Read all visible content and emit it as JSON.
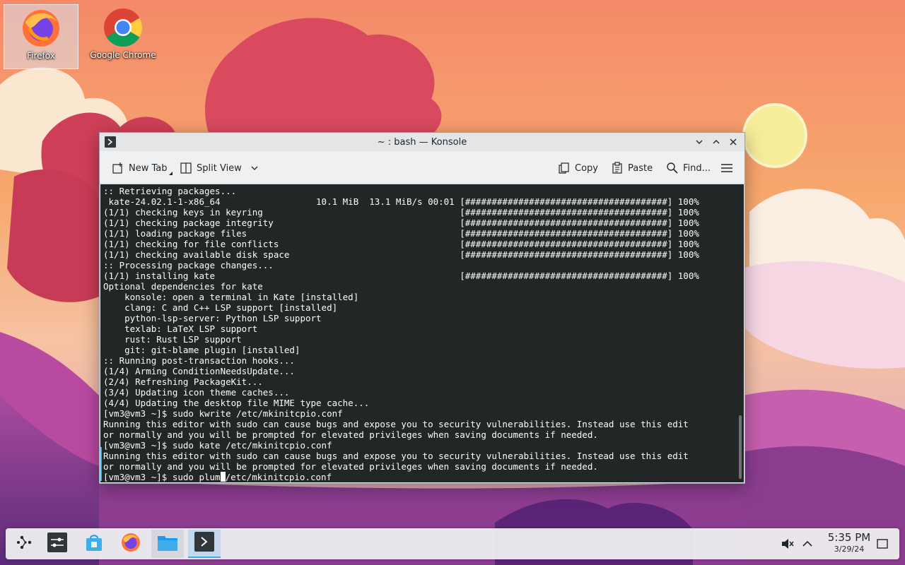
{
  "desktop": {
    "icons": [
      {
        "label": "Firefox",
        "icon": "firefox-icon",
        "selected": true
      },
      {
        "label": "Google Chrome",
        "icon": "chrome-icon",
        "selected": false
      }
    ]
  },
  "window": {
    "title": "~ : bash — Konsole",
    "toolbar": {
      "new_tab": "New Tab",
      "split_view": "Split View",
      "copy": "Copy",
      "paste": "Paste",
      "find": "Find..."
    },
    "terminal": {
      "lines": [
        ":: Retrieving packages...",
        " kate-24.02.1-1-x86_64                  10.1 MiB  13.1 MiB/s 00:01 [######################################] 100%",
        "(1/1) checking keys in keyring                                     [######################################] 100%",
        "(1/1) checking package integrity                                   [######################################] 100%",
        "(1/1) loading package files                                        [######################################] 100%",
        "(1/1) checking for file conflicts                                  [######################################] 100%",
        "(1/1) checking available disk space                                [######################################] 100%",
        ":: Processing package changes...",
        "(1/1) installing kate                                              [######################################] 100%",
        "Optional dependencies for kate",
        "    konsole: open a terminal in Kate [installed]",
        "    clang: C and C++ LSP support [installed]",
        "    python-lsp-server: Python LSP support",
        "    texlab: LaTeX LSP support",
        "    rust: Rust LSP support",
        "    git: git-blame plugin [installed]",
        ":: Running post-transaction hooks...",
        "(1/4) Arming ConditionNeedsUpdate...",
        "(2/4) Refreshing PackageKit...",
        "(3/4) Updating icon theme caches...",
        "(4/4) Updating the desktop file MIME type cache...",
        "[vm3@vm3 ~]$ sudo kwrite /etc/mkinitcpio.conf",
        "Running this editor with sudo can cause bugs and expose you to security vulnerabilities. Instead use this edit",
        "or normally and you will be prompted for elevated privileges when saving documents if needed.",
        "[vm3@vm3 ~]$ sudo kate /etc/mkinitcpio.conf",
        "Running this editor with sudo can cause bugs and expose you to security vulnerabilities. Instead use this edit",
        "or normally and you will be prompted for elevated privileges when saving documents if needed."
      ],
      "prompt_before_cursor": "[vm3@vm3 ~]$ sudo plum",
      "prompt_after_cursor": "/etc/mkinitcpio.conf"
    }
  },
  "taskbar": {
    "items": [
      {
        "name": "app-launcher",
        "icon": "launcher-icon"
      },
      {
        "name": "system-settings",
        "icon": "settings-icon"
      },
      {
        "name": "discover",
        "icon": "store-icon"
      },
      {
        "name": "firefox",
        "icon": "firefox-icon"
      },
      {
        "name": "dolphin",
        "icon": "folder-icon"
      },
      {
        "name": "konsole",
        "icon": "terminal-icon"
      }
    ],
    "clock": {
      "time": "5:35 PM",
      "date": "3/29/24"
    }
  },
  "colors": {
    "terminal_bg": "#232627",
    "terminal_fg": "#fcfcfc",
    "accent": "#3daee9"
  }
}
